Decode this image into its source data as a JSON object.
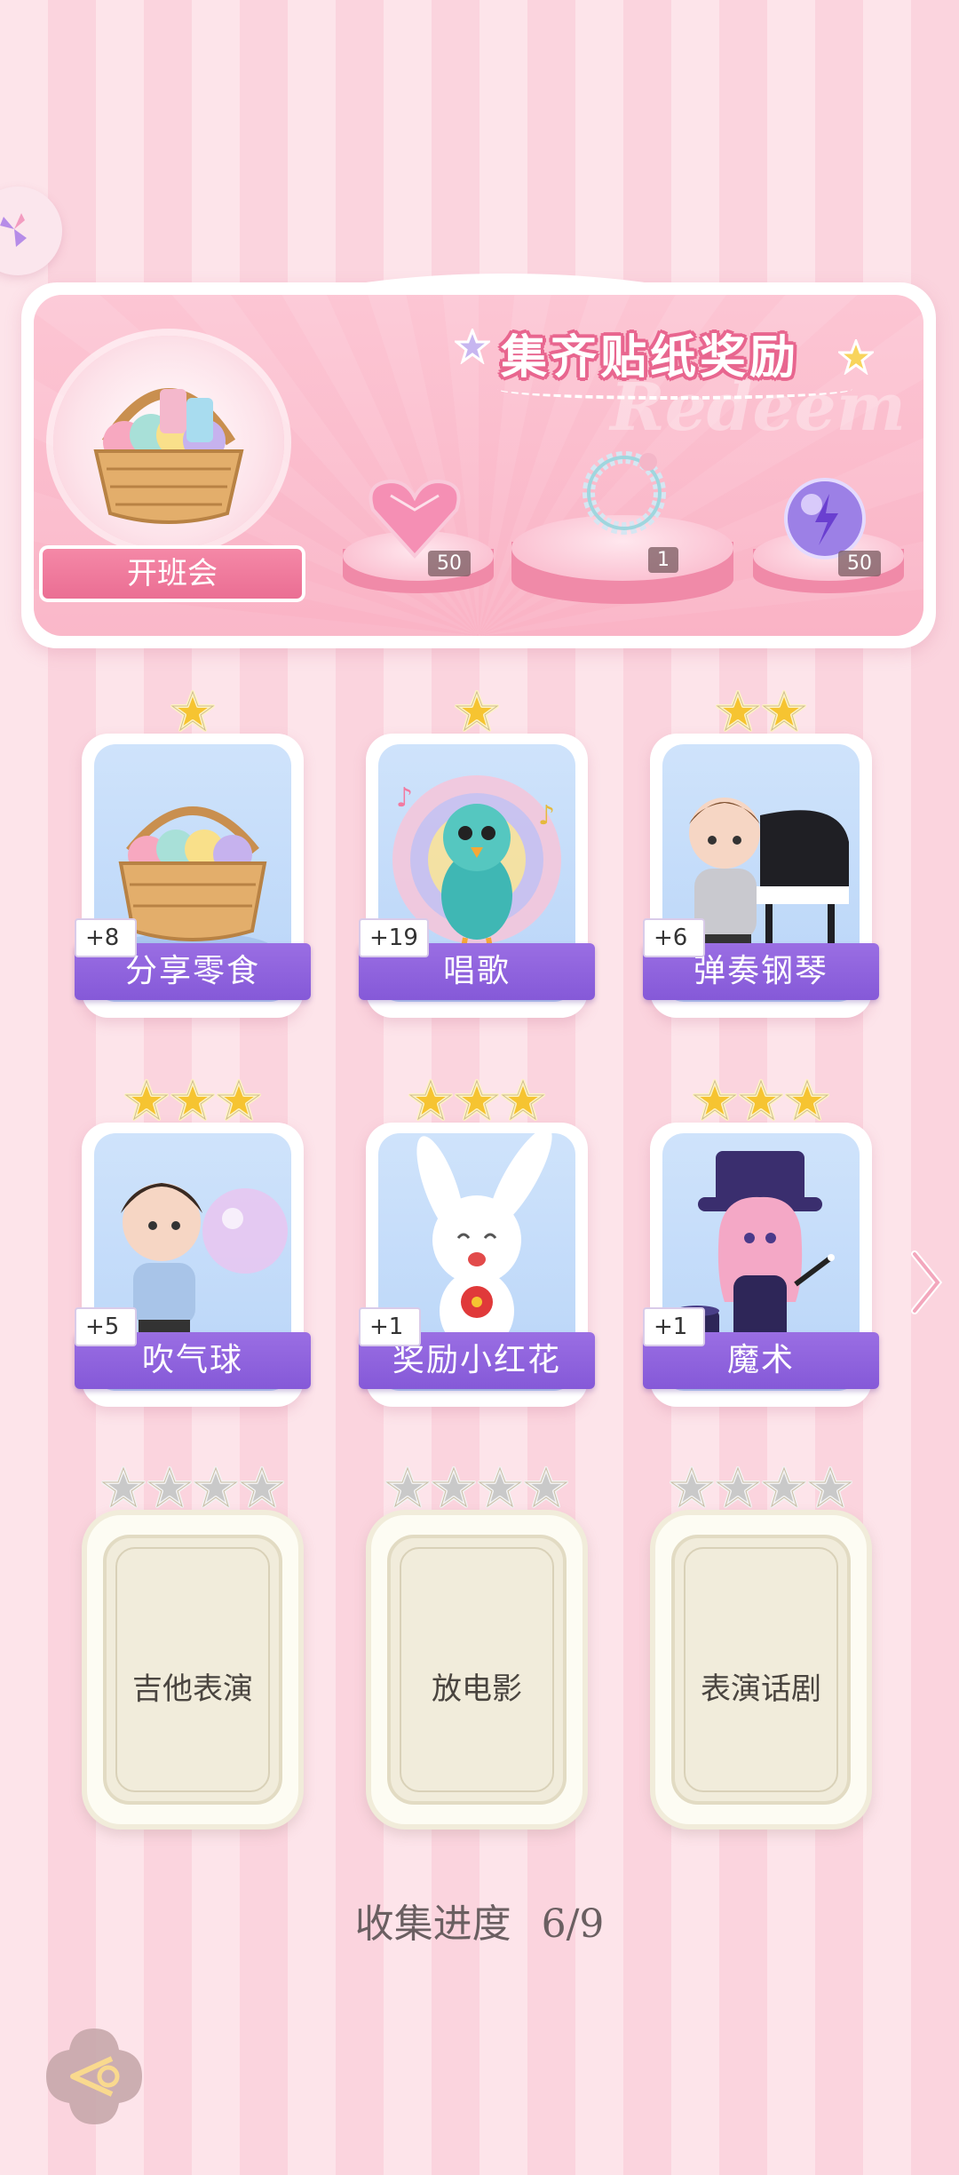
{
  "banner": {
    "title": "集齐贴纸奖励",
    "watermark": "Redeem",
    "basket_label": "开班会",
    "rewards": [
      {
        "icon": "heart-gem-icon",
        "count": "50"
      },
      {
        "icon": "bracelet-icon",
        "count": "1"
      },
      {
        "icon": "energy-orb-icon",
        "count": "50"
      }
    ]
  },
  "cards": [
    {
      "label": "分享零食",
      "plus": "+8",
      "stars": 1,
      "art": "snack-basket-icon",
      "unlocked": true
    },
    {
      "label": "唱歌",
      "plus": "+19",
      "stars": 1,
      "art": "peacock-icon",
      "unlocked": true
    },
    {
      "label": "弹奏钢琴",
      "plus": "+6",
      "stars": 2,
      "art": "piano-boy-icon",
      "unlocked": true
    },
    {
      "label": "吹气球",
      "plus": "+5",
      "stars": 3,
      "art": "bubble-boy-icon",
      "unlocked": true
    },
    {
      "label": "奖励小红花",
      "plus": "+1",
      "stars": 3,
      "art": "bunny-flower-icon",
      "unlocked": true
    },
    {
      "label": "魔术",
      "plus": "+1",
      "stars": 3,
      "art": "magician-girl-icon",
      "unlocked": true
    },
    {
      "label": "吉他表演",
      "stars": 4,
      "unlocked": false
    },
    {
      "label": "放电影",
      "stars": 4,
      "unlocked": false
    },
    {
      "label": "表演话剧",
      "stars": 4,
      "unlocked": false
    }
  ],
  "progress": {
    "label": "收集进度",
    "value": "6/9"
  },
  "colors": {
    "accent_purple": "#8559d8",
    "pink": "#ea6c92",
    "gold_star": "#f6c431",
    "grey_star": "#c9c9c9"
  }
}
